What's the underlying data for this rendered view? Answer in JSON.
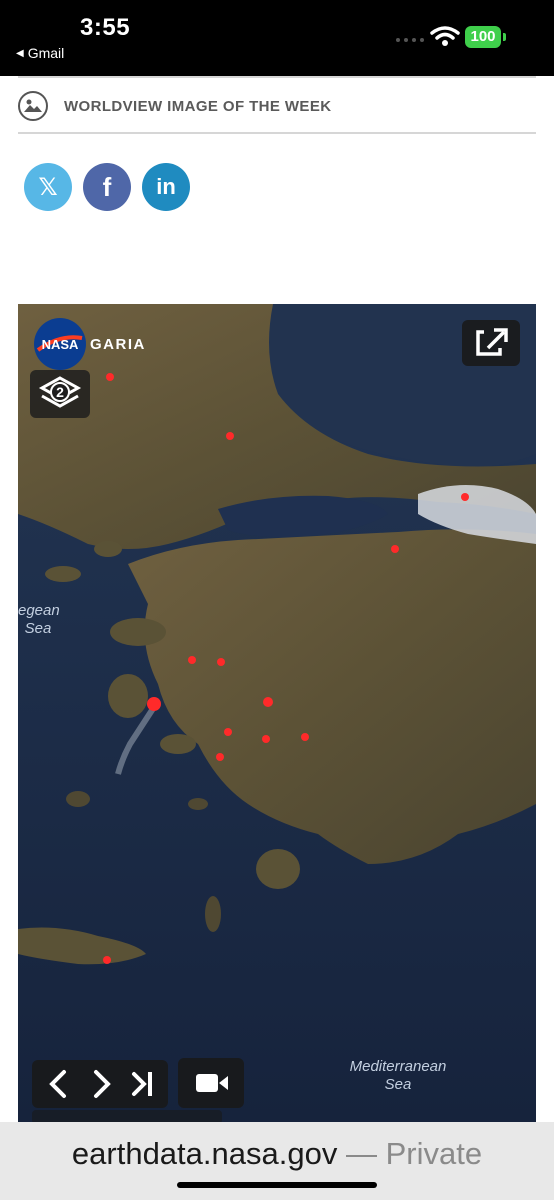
{
  "status_bar": {
    "time": "3:55",
    "back_app": "Gmail",
    "battery": "100"
  },
  "section": {
    "title": "WORLDVIEW IMAGE OF THE WEEK",
    "icon": "image-icon"
  },
  "social": {
    "twitter": "𝕏",
    "facebook": "f",
    "linkedin": "in"
  },
  "map": {
    "country_label": "GARIA",
    "sea_labels": {
      "aegean_line1": "egean",
      "aegean_line2": "Sea",
      "mediterranean_line1": "Mediterranean",
      "mediterranean_line2": "Sea"
    },
    "nasa_logo_text": "NASA",
    "layers_badge": "2",
    "controls": [
      "previous",
      "next",
      "last",
      "video"
    ]
  },
  "address_bar": {
    "domain": "earthdata.nasa.gov",
    "separator": "—",
    "mode": "Private"
  },
  "colors": {
    "battery": "#3fcf4b",
    "twitter": "#57b7e6",
    "facebook": "#4f67a8",
    "linkedin": "#1f8bc0",
    "fire": "#ff2a2a"
  }
}
